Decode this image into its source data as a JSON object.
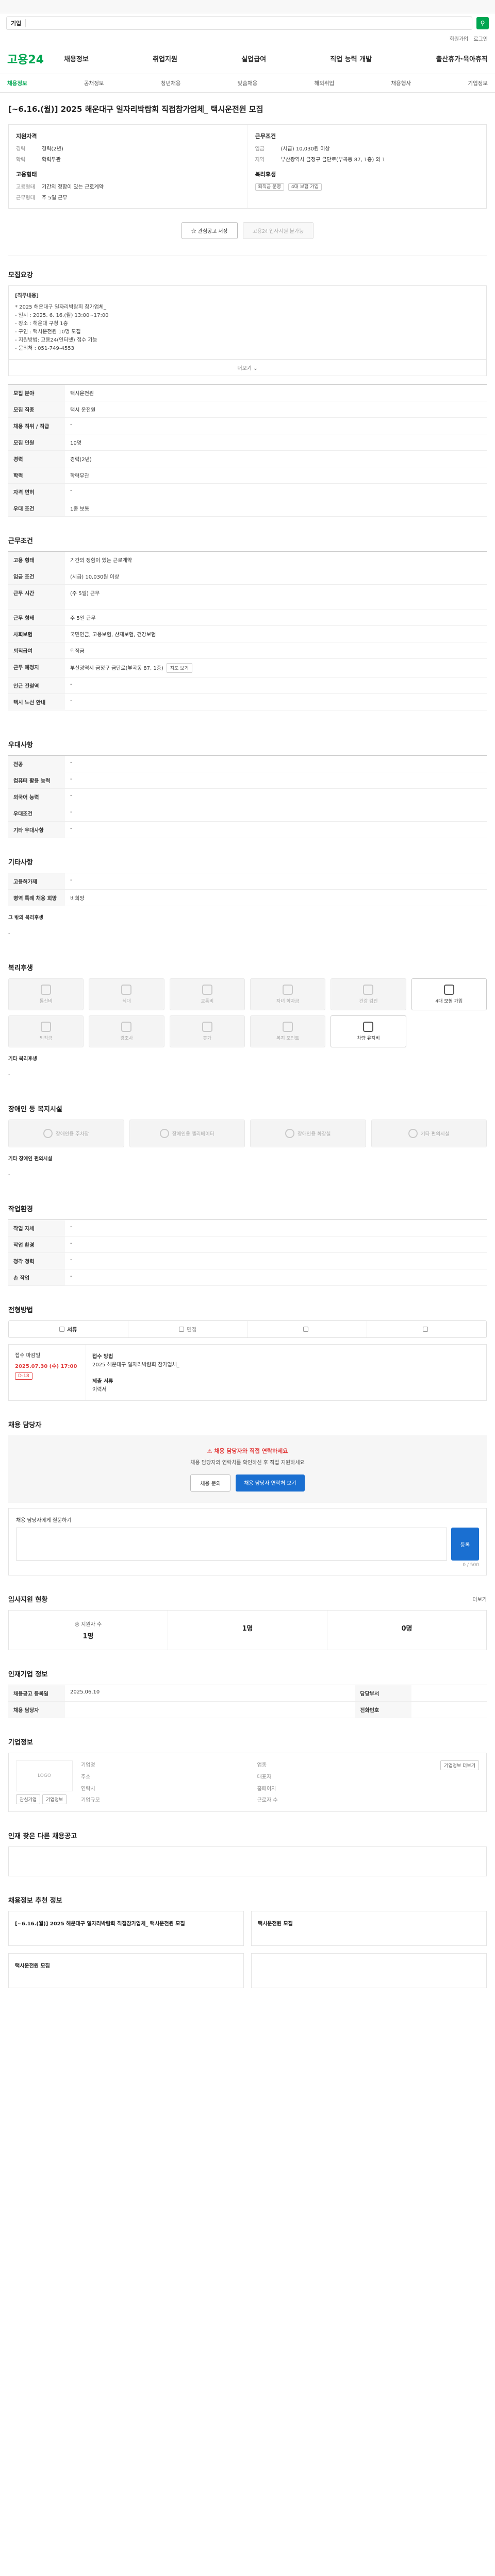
{
  "notice": "",
  "search": {
    "tag": "기업",
    "placeholder": ""
  },
  "top_links": [
    "회원가입",
    "로그인"
  ],
  "logo": "고용24",
  "gnb": [
    "채용정보",
    "취업지원",
    "실업급여",
    "직업 능력 개발",
    "출산휴가·육아휴직"
  ],
  "subnav": [
    "채용정보",
    "공채정보",
    "청년채용",
    "맞춤채용",
    "해외취업",
    "채용행사",
    "기업정보"
  ],
  "title": "[~6.16.(월)] 2025 해운대구 일자리박람회 직접참가업체_ 택시운전원 모집",
  "summary": {
    "left_title": "지원자격",
    "left_rows": [
      {
        "k": "경력",
        "v": "경력(2년)"
      },
      {
        "k": "학력",
        "v": "학력무관"
      }
    ],
    "left_title2": "고용형태",
    "left_rows2": [
      {
        "k": "고용형태",
        "v": "기간의 정함이 있는 근로계약"
      },
      {
        "k": "근무형태",
        "v": "주 5일 근무"
      }
    ],
    "right_title": "근무조건",
    "right_rows": [
      {
        "k": "임금",
        "v": "(시급) 10,030원 이상"
      },
      {
        "k": "지역",
        "v": "부산광역시 금정구 금단로(부곡동 87, 1층) 외 1"
      }
    ],
    "right_title2": "복리후생",
    "chips": [
      "퇴직금 운영",
      "4대 보험 가입"
    ]
  },
  "actions": {
    "scrap": "관심공고 저장",
    "apply": "고용24 입사지원 불가능"
  },
  "sec_detail": {
    "title": "모집요강",
    "head": "[직무내용]",
    "lines": [
      "* 2025 해운대구 일자리박람회 참가업체_",
      "- 일시 : 2025. 6. 16.(월) 13:00~17:00",
      "- 장소 : 해운대 구청 1층",
      "- 구인 : 택시운전원 10명 모집",
      "- 지원방법: 고용24(인터넷) 접수 가능",
      "- 문의처 : 051-749-4553"
    ],
    "more": "더보기"
  },
  "recruit_table": [
    {
      "k": "모집 분야",
      "v": "택시운전원"
    },
    {
      "k": "모집 직종",
      "v": "택시 운전원"
    },
    {
      "k": "채용 직위 / 직급",
      "v": "-"
    },
    {
      "k": "모집 인원",
      "v": "10명"
    },
    {
      "k": "경력",
      "v": "경력(2년)"
    },
    {
      "k": "학력",
      "v": "학력무관"
    },
    {
      "k": "자격 면허",
      "v": "-"
    },
    {
      "k": "우대 조건",
      "v": "1종 보통"
    }
  ],
  "cond": {
    "title": "근무조건",
    "rows": [
      {
        "k": "고용 형태",
        "v": "기간의 정함이 있는 근로계약"
      },
      {
        "k": "임금 조건",
        "v": "(시급) 10,030원 이상"
      },
      {
        "k": "근무 시간",
        "v": "(주 5일) 근무"
      },
      {
        "k": "근무 형태",
        "v": "주 5일 근무"
      },
      {
        "k": "사회보험",
        "v": "국민연금, 고용보험, 산재보험, 건강보험"
      },
      {
        "k": "퇴직급여",
        "v": "퇴직금"
      },
      {
        "k": "근무 예정지",
        "v": "부산광역시 금정구 금단로(부곡동 87, 1층)"
      },
      {
        "k": "인근 전철역",
        "v": "-"
      },
      {
        "k": "택시 노선 안내",
        "v": "-"
      }
    ],
    "map_btn": "지도 보기",
    "note": ""
  },
  "prefer": {
    "title": "우대사항",
    "rows": [
      {
        "k": "전공",
        "v": "-"
      },
      {
        "k": "컴퓨터 활용 능력",
        "v": "-"
      },
      {
        "k": "외국어 능력",
        "v": "-"
      },
      {
        "k": "우대조건",
        "v": "-"
      },
      {
        "k": "기타 우대사항",
        "v": "-"
      }
    ]
  },
  "etc": {
    "title": "기타사항",
    "rows": [
      {
        "k": "고용허가제",
        "v": "-"
      },
      {
        "k": "병역 특례 채용 희망",
        "v": "비희망"
      }
    ],
    "sub": "그 밖의 복리후생"
  },
  "welfare": {
    "title": "복리후생",
    "tiles": [
      "통신비",
      "식대",
      "교통비",
      "자녀 학자금",
      "건강 검진",
      "4대 보험 가입",
      "퇴직금",
      "경조사",
      "휴가",
      "복지 포인트",
      "차량 유지비",
      "기타"
    ],
    "sub": "기타 복리후생"
  },
  "disabled": {
    "title": "장애인 등 복지시설",
    "tiles": [
      "장애인용 주차장",
      "장애인용 엘리베이터",
      "장애인용 화장실",
      "기타 편의시설"
    ],
    "sub": "기타 장애인 편의시설"
  },
  "conditions_ex": {
    "title": "작업환경",
    "rows": [
      {
        "k": "작업 자세",
        "v": "-",
        "k2": "",
        "v2": ""
      },
      {
        "k": "작업 환경",
        "v": "-",
        "k2": "",
        "v2": ""
      },
      {
        "k": "청각 청력",
        "v": "-",
        "k2": "",
        "v2": ""
      },
      {
        "k": "손 작업",
        "v": "-",
        "k2": "",
        "v2": ""
      }
    ]
  },
  "process": {
    "title": "전형방법",
    "steps": [
      "서류",
      "면접",
      "",
      ""
    ],
    "period_label": "접수 마감일",
    "period_date": "2025.07.30 (수) 17:00",
    "badge": "D-18",
    "right_label": "접수 방법",
    "right_text": "2025 해운대구 일자리박람회 참가업체_",
    "right_label2": "제출 서류",
    "right_text2": "이력서"
  },
  "bullets": [],
  "apply": {
    "title": "채용 담당자",
    "warn": "채용 담당자와 직접 연락하세요",
    "desc": "채용 담당자의 연락처를 확인하신 후 직접 지원하세요",
    "b1": "채용 문의",
    "b2": "채용 담당자 연락처 보기"
  },
  "qa": {
    "title": "채용 담당자에게 질문하기",
    "right": "",
    "placeholder": "",
    "count": "0 / 500",
    "send": "등록",
    "foot": []
  },
  "status": {
    "title": "입사지원 현황",
    "more": "더보기",
    "items": [
      {
        "l": "총 지원자 수",
        "n": "1명"
      },
      {
        "l": "",
        "n": "1명"
      },
      {
        "l": "",
        "n": "0명"
      }
    ],
    "note": ""
  },
  "manager": {
    "title": "인재기업 정보",
    "rows": [
      {
        "k": "채용공고 등록일",
        "v": "2025.06.10",
        "k2": "담당부서",
        "v2": "",
        "btn": ""
      },
      {
        "k": "채용 담당자",
        "v": "",
        "k2": "전화번호",
        "v2": ""
      }
    ],
    "note": ""
  },
  "company": {
    "title": "기업정보",
    "logo": "LOGO",
    "b1": "관심기업",
    "b2": "기업정보",
    "rows": [
      {
        "k": "기업명",
        "v": "",
        "k2": "업종",
        "v2": ""
      },
      {
        "k": "주소",
        "v": "",
        "k2": "대표자",
        "v2": ""
      },
      {
        "k": "연락처",
        "v": "",
        "k2": "홈페이지",
        "v2": ""
      },
      {
        "k": "기업규모",
        "v": "",
        "k2": "근로자 수",
        "v2": ""
      }
    ],
    "btn": "기업정보 더보기"
  },
  "similar": {
    "title": "인재 찾은 다른 채용공고",
    "empty": "",
    "right": ""
  },
  "recommend": {
    "title": "채용정보 추천 정보",
    "cards": [
      {
        "org": "",
        "title": "[~6.16.(월)] 2025 해운대구 일자리박람회 직접참가업체_ 택시운전원 모집",
        "meta": ""
      },
      {
        "org": "",
        "title": "택시운전원 모집",
        "meta": ""
      },
      {
        "org": "",
        "title": "택시운전원 모집",
        "meta": ""
      },
      {
        "org": "",
        "title": "",
        "meta": ""
      }
    ]
  },
  "colors": {
    "brand": "#00a651",
    "accent": "#1a6fd1",
    "alert": "#e23b3b"
  }
}
